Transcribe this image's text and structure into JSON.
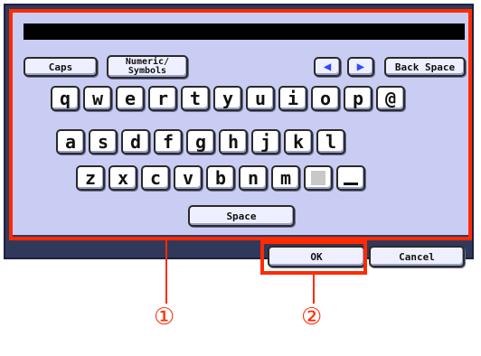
{
  "keyboard": {
    "top_row": {
      "caps": "Caps",
      "numeric_symbols": "Numeric/\nSymbols",
      "left_arrow": "◀",
      "right_arrow": "▶",
      "back_space": "Back Space"
    },
    "rows": [
      [
        "q",
        "w",
        "e",
        "r",
        "t",
        "y",
        "u",
        "i",
        "o",
        "p",
        "@"
      ],
      [
        "a",
        "s",
        "d",
        "f",
        "g",
        "h",
        "j",
        "k",
        "l"
      ],
      [
        "z",
        "x",
        "c",
        "v",
        "b",
        "n",
        "m",
        "",
        ""
      ]
    ],
    "space": "Space"
  },
  "actions": {
    "ok": "OK",
    "cancel": "Cancel"
  },
  "annotations": {
    "callout_1": "①",
    "callout_2": "②",
    "highlight_color": "#ff2a00"
  }
}
